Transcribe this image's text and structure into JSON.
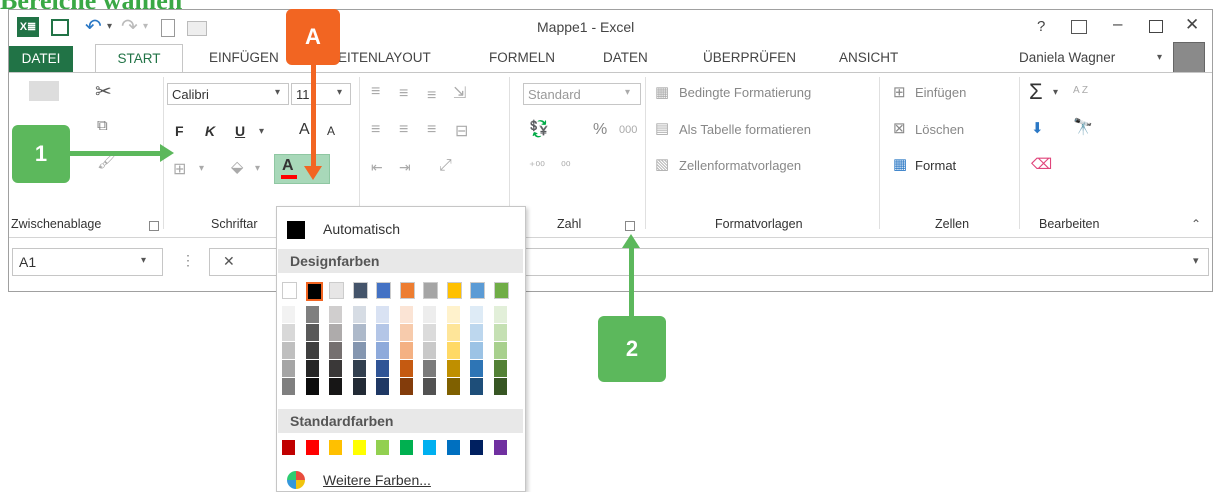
{
  "page_heading": "Bereiche wählen",
  "window": {
    "title": "Mappe1 - Excel",
    "help": "?",
    "user": "Daniela Wagner"
  },
  "tabs": [
    "DATEI",
    "START",
    "EINFÜGEN",
    "SEITENLAYOUT",
    "FORMELN",
    "DATEN",
    "ÜBERPRÜFEN",
    "ANSICHT"
  ],
  "ribbon": {
    "font_name": "Calibri",
    "font_size": "11",
    "bold": "F",
    "italic": "K",
    "underline": "U",
    "font_grow": "A",
    "font_shrink": "A",
    "font_color": "A",
    "number_format": "Standard",
    "percent": "%",
    "thousands": "000",
    "decimal_inc": "⁺⁰⁰",
    "decimal_dec": "⁰⁰",
    "cond_format": "Bedingte Formatierung",
    "as_table": "Als Tabelle formatieren",
    "cell_styles": "Zellenformatvorlagen",
    "insert": "Einfügen",
    "delete": "Löschen",
    "format": "Format",
    "sum": "Σ",
    "sort_label": "A Z",
    "paste_partial": "n",
    "groups": {
      "clipboard": "Zwischenablage",
      "font": "Schriftar",
      "number": "Zahl",
      "styles": "Formatvorlagen",
      "cells": "Zellen",
      "edit": "Bearbeiten"
    }
  },
  "formula_bar": {
    "name_box": "A1",
    "cancel": "✕"
  },
  "callouts": {
    "one": "1",
    "two": "2",
    "a": "A"
  },
  "color_menu": {
    "automatic": "Automatisch",
    "theme_header": "Designfarben",
    "standard_header": "Standardfarben",
    "more_colors": "Weitere Farben...",
    "theme_top": [
      "#ffffff",
      "#000000",
      "#e7e6e6",
      "#44546a",
      "#4472c4",
      "#ed7d31",
      "#a5a5a5",
      "#ffc000",
      "#5b9bd5",
      "#70ad47"
    ],
    "theme_shades": [
      [
        "#f2f2f2",
        "#7f7f7f",
        "#d0cece",
        "#d6dce4",
        "#d9e2f3",
        "#fbe4d5",
        "#ededed",
        "#fff2cc",
        "#deebf6",
        "#e2efd9"
      ],
      [
        "#d8d8d8",
        "#595959",
        "#aeabab",
        "#adb9ca",
        "#b4c6e7",
        "#f7cbac",
        "#dbdbdb",
        "#fee599",
        "#bdd7ee",
        "#c5e0b3"
      ],
      [
        "#bfbfbf",
        "#3f3f3f",
        "#757070",
        "#8496b0",
        "#8eaadb",
        "#f4b183",
        "#c9c9c9",
        "#ffd965",
        "#9cc3e5",
        "#a8d08d"
      ],
      [
        "#a5a5a5",
        "#262626",
        "#3a3838",
        "#323f4f",
        "#2f5496",
        "#c55a11",
        "#7b7b7b",
        "#bf8f00",
        "#2e75b5",
        "#538135"
      ],
      [
        "#7f7f7f",
        "#0c0c0c",
        "#171616",
        "#222a35",
        "#1f3864",
        "#833c0b",
        "#525252",
        "#7f6000",
        "#1e4e79",
        "#375623"
      ]
    ],
    "standard": [
      "#c00000",
      "#ff0000",
      "#ffc000",
      "#ffff00",
      "#92d050",
      "#00b050",
      "#00b0f0",
      "#0070c0",
      "#002060",
      "#7030a0"
    ]
  }
}
